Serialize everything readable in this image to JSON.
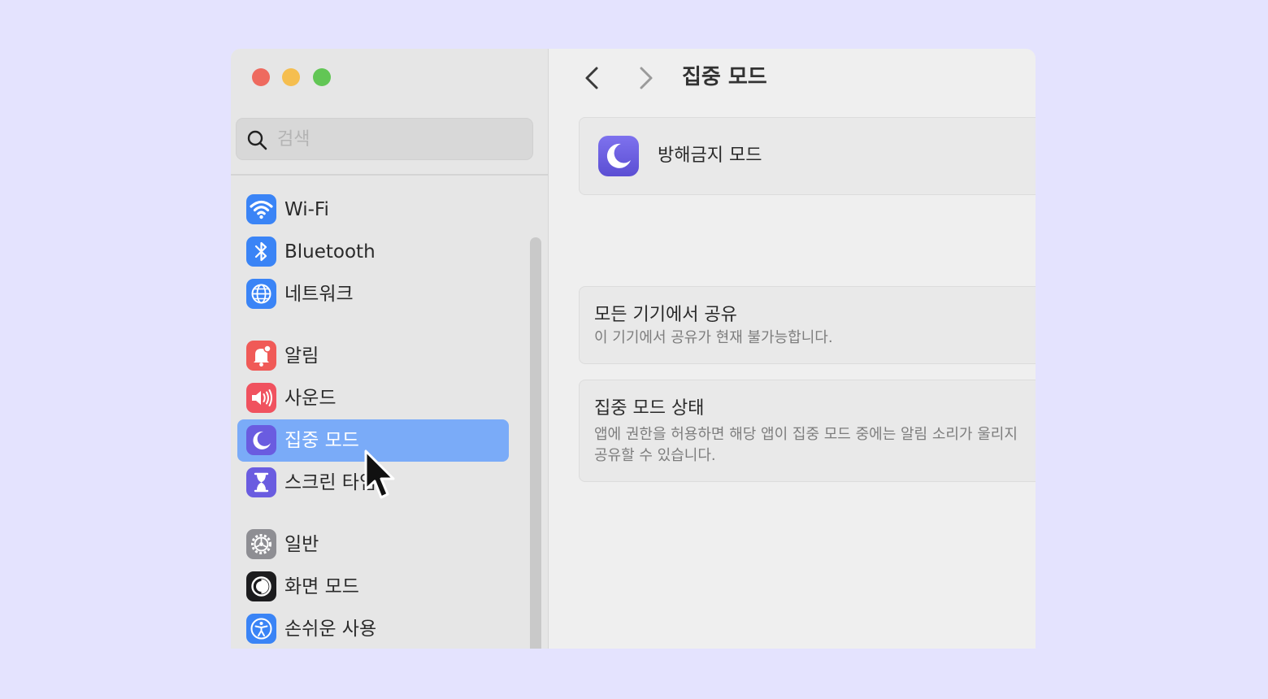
{
  "window": {
    "traffic_lights": [
      "close",
      "minimize",
      "zoom"
    ]
  },
  "sidebar": {
    "search": {
      "placeholder": "검색",
      "value": ""
    },
    "items": [
      {
        "label": "Wi-Fi",
        "icon": "wifi-icon",
        "color": "#3a84f6"
      },
      {
        "label": "Bluetooth",
        "icon": "bluetooth-icon",
        "color": "#3a84f6"
      },
      {
        "label": "네트워크",
        "icon": "globe-icon",
        "color": "#3a84f6"
      },
      {
        "label": "알림",
        "icon": "bell-icon",
        "color": "#f05a57"
      },
      {
        "label": "사운드",
        "icon": "speaker-icon",
        "color": "#f0525f"
      },
      {
        "label": "집중 모드",
        "icon": "moon-icon",
        "color": "#6a5ce0",
        "selected": true
      },
      {
        "label": "스크린 타임",
        "icon": "hourglass-icon",
        "color": "#6a5ce0"
      },
      {
        "label": "일반",
        "icon": "gear-icon",
        "color": "#8e8e93"
      },
      {
        "label": "화면 모드",
        "icon": "appearance-icon",
        "color": "#1c1c1e"
      },
      {
        "label": "손쉬운 사용",
        "icon": "accessibility-icon",
        "color": "#3a84f6"
      }
    ]
  },
  "header": {
    "title": "집중 모드"
  },
  "main": {
    "focus_item": {
      "label": "방해금지 모드",
      "icon": "moon-icon"
    },
    "share": {
      "title": "모든 기기에서 공유",
      "subtitle": "이 기기에서 공유가 현재 불가능합니다."
    },
    "status": {
      "title": "집중 모드 상태",
      "subtitle_line1": "앱에 권한을 허용하면 해당 앱이 집중 모드 중에는 알림 소리가 울리지",
      "subtitle_line2": "공유할 수 있습니다."
    }
  }
}
